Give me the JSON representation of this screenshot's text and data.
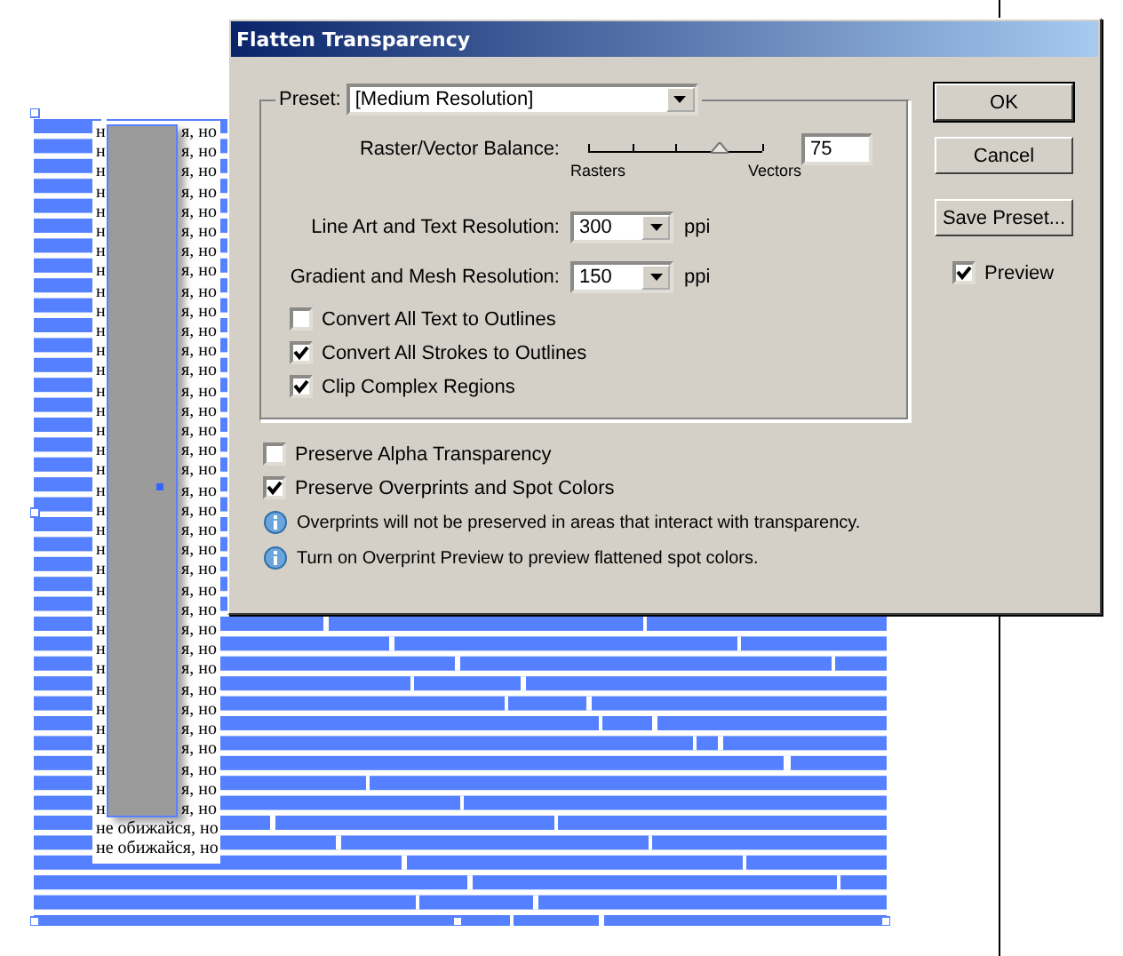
{
  "dialog": {
    "title": "Flatten Transparency",
    "preset": {
      "label": "Preset:",
      "value": "[Medium Resolution]"
    },
    "balance": {
      "label": "Raster/Vector Balance:",
      "level": 0.75,
      "min_label": "Rasters",
      "max_label": "Vectors",
      "value": "75"
    },
    "resolutions": [
      {
        "label": "Line Art and Text Resolution:",
        "value": "300",
        "unit": "ppi"
      },
      {
        "label": "Gradient and Mesh Resolution:",
        "value": "150",
        "unit": "ppi"
      }
    ],
    "group_options": [
      {
        "label": "Convert All Text to Outlines",
        "checked": false
      },
      {
        "label": "Convert All Strokes to Outlines",
        "checked": true
      },
      {
        "label": "Clip Complex Regions",
        "checked": true
      }
    ],
    "options": [
      {
        "label": "Preserve Alpha Transparency",
        "checked": false
      },
      {
        "label": "Preserve Overprints and Spot Colors",
        "checked": true
      }
    ],
    "notes": [
      "Overprints will not be preserved in areas that interact with transparency.",
      "Turn on Overprint Preview to preview flattened spot colors."
    ],
    "buttons": [
      {
        "label": "OK",
        "default": true
      },
      {
        "label": "Cancel",
        "default": false
      },
      {
        "label": "Save Preset...",
        "default": false
      }
    ],
    "preview": {
      "label": "Preview",
      "checked": true
    }
  },
  "canvas": {
    "text_rows": [
      {
        "kind": "covered",
        "left": "н",
        "right": "я, но"
      },
      {
        "kind": "covered",
        "left": "н",
        "right": "я, но"
      },
      {
        "kind": "covered",
        "left": "н",
        "right": "я, но"
      },
      {
        "kind": "covered",
        "left": "н",
        "right": "я, но"
      },
      {
        "kind": "covered",
        "left": "н",
        "right": "я, но"
      },
      {
        "kind": "covered",
        "left": "н",
        "right": "я, но"
      },
      {
        "kind": "covered",
        "left": "н",
        "right": "я, но"
      },
      {
        "kind": "covered",
        "left": "н",
        "right": "я, но"
      },
      {
        "kind": "covered",
        "left": "н",
        "right": "я, но"
      },
      {
        "kind": "covered",
        "left": "н",
        "right": "я, но"
      },
      {
        "kind": "covered",
        "left": "н",
        "right": "я, но"
      },
      {
        "kind": "covered",
        "left": "н",
        "right": "я, но"
      },
      {
        "kind": "covered",
        "left": "н",
        "right": "я, но"
      },
      {
        "kind": "covered",
        "left": "н",
        "right": "я, но"
      },
      {
        "kind": "covered",
        "left": "н",
        "right": "я, но"
      },
      {
        "kind": "covered",
        "left": "н",
        "right": "я, но"
      },
      {
        "kind": "covered",
        "left": "н",
        "right": "я, но"
      },
      {
        "kind": "covered",
        "left": "н",
        "right": "я, но"
      },
      {
        "kind": "covered",
        "left": "н",
        "right": "я, но"
      },
      {
        "kind": "covered",
        "left": "н",
        "right": "я, но"
      },
      {
        "kind": "covered",
        "left": "н",
        "right": "я, но"
      },
      {
        "kind": "covered",
        "left": "н",
        "right": "я, но"
      },
      {
        "kind": "covered",
        "left": "н",
        "right": "я, но"
      },
      {
        "kind": "covered",
        "left": "н",
        "right": "я, но"
      },
      {
        "kind": "covered",
        "left": "н",
        "right": "я, но"
      },
      {
        "kind": "covered",
        "left": "н",
        "right": "я, но"
      },
      {
        "kind": "covered",
        "left": "н",
        "right": "я, но"
      },
      {
        "kind": "covered",
        "left": "н",
        "right": "я, но"
      },
      {
        "kind": "covered",
        "left": "н",
        "right": "я, но"
      },
      {
        "kind": "covered",
        "left": "н",
        "right": "я, но"
      },
      {
        "kind": "covered",
        "left": "н",
        "right": "я, но"
      },
      {
        "kind": "covered",
        "left": "н",
        "right": "я, но"
      },
      {
        "kind": "covered",
        "left": "н",
        "right": "я, но"
      },
      {
        "kind": "covered",
        "left": "н",
        "right": "я, но"
      },
      {
        "kind": "covered",
        "left": "н",
        "right": "я, но"
      },
      {
        "kind": "full",
        "text": "не обижайся, но"
      },
      {
        "kind": "full",
        "text": "не обижайся, но"
      }
    ]
  }
}
